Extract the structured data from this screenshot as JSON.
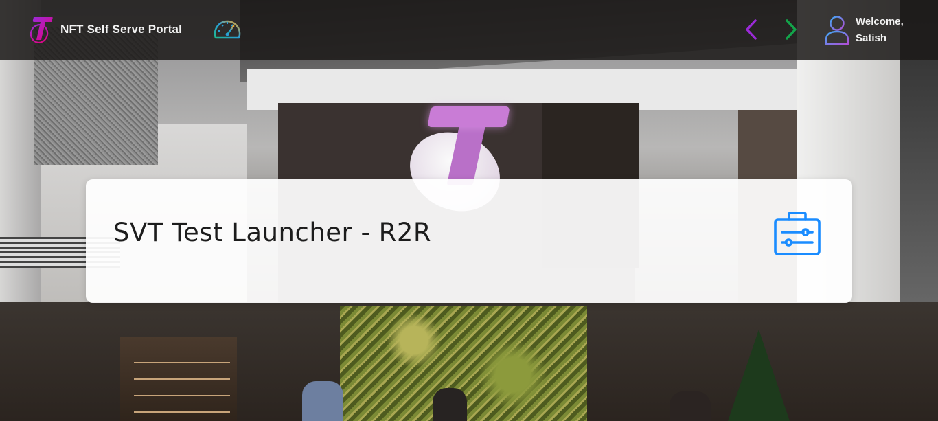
{
  "header": {
    "app_title": "NFT Self Serve Portal",
    "logo_icon": "telstra-logo-icon",
    "dashboard_icon": "speedometer-icon",
    "nav": {
      "prev_icon": "chevron-left-icon",
      "next_icon": "chevron-right-icon"
    },
    "user": {
      "greeting": "Welcome,",
      "name": "Satish",
      "avatar_icon": "user-icon"
    }
  },
  "main": {
    "card": {
      "title": "SVT Test Launcher - R2R",
      "icon": "toolbox-icon",
      "icon_color": "#1a8cff"
    }
  },
  "colors": {
    "brand_gradient_start": "#9b2ad8",
    "brand_gradient_end": "#e5007d",
    "prev_arrow": "#9b2ad8",
    "next_arrow": "#13a34a",
    "header_bg": "#1c1a19"
  }
}
